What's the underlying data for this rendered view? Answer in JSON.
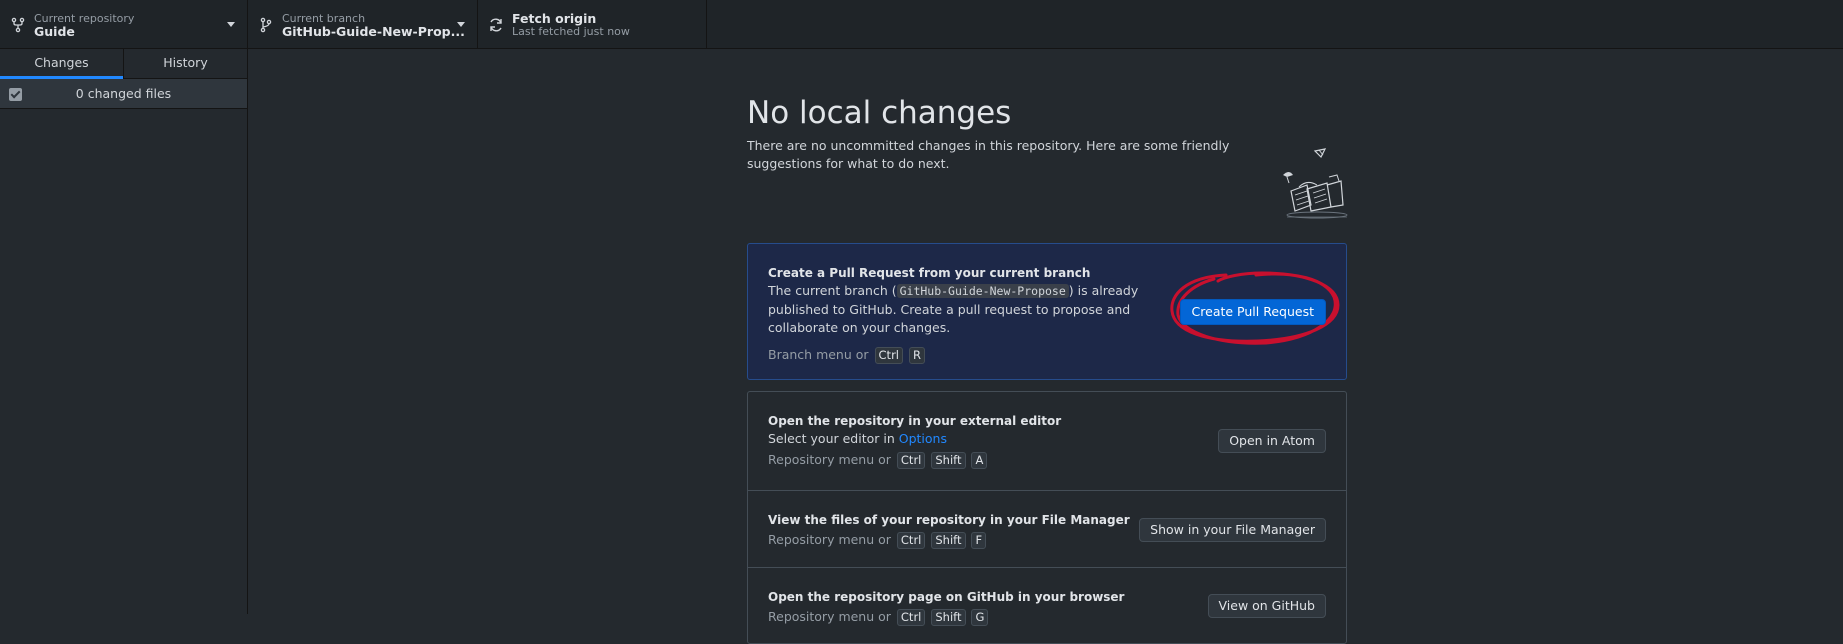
{
  "toolbar": {
    "repo_label": "Current repository",
    "repo_name": "Guide",
    "branch_label": "Current branch",
    "branch_name": "GitHub-Guide-New-Prop...",
    "fetch_label": "Fetch origin",
    "fetch_status": "Last fetched just now"
  },
  "sidebar": {
    "tabs": [
      {
        "label": "Changes"
      },
      {
        "label": "History"
      }
    ],
    "changed_files": "0 changed files"
  },
  "main": {
    "title": "No local changes",
    "subtitle": "There are no uncommitted changes in this repository. Here are some friendly suggestions for what to do next.",
    "pull_request": {
      "title": "Create a Pull Request from your current branch",
      "desc_pre": "The current branch (",
      "branch_code": "GitHub-Guide-New-Propose",
      "desc_post": ") is already published to GitHub. Create a pull request to propose and collaborate on your changes.",
      "shortcut_text": "Branch menu or",
      "keys": [
        "Ctrl",
        "R"
      ],
      "button": "Create Pull Request"
    },
    "actions": [
      {
        "title": "Open the repository in your external editor",
        "desc_pre": "Select your editor in ",
        "link": "Options",
        "shortcut_text": "Repository menu or",
        "keys": [
          "Ctrl",
          "Shift",
          "A"
        ],
        "button": "Open in Atom"
      },
      {
        "title": "View the files of your repository in your File Manager",
        "shortcut_text": "Repository menu or",
        "keys": [
          "Ctrl",
          "Shift",
          "F"
        ],
        "button": "Show in your File Manager"
      },
      {
        "title": "Open the repository page on GitHub in your browser",
        "shortcut_text": "Repository menu or",
        "keys": [
          "Ctrl",
          "Shift",
          "G"
        ],
        "button": "View on GitHub"
      }
    ]
  },
  "colors": {
    "accent": "#0366d6",
    "annotation": "#c8102e"
  }
}
